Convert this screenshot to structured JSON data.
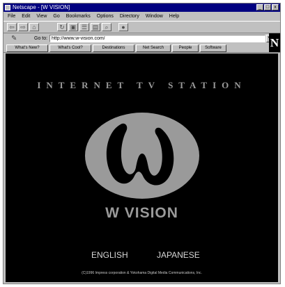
{
  "window": {
    "title": "Netscape - [W VISION]",
    "buttons": [
      "_",
      "□",
      "x"
    ]
  },
  "menu": [
    "File",
    "Edit",
    "View",
    "Go",
    "Bookmarks",
    "Options",
    "Directory",
    "Window",
    "Help"
  ],
  "toolbar": {
    "icons": [
      "back-icon",
      "forward-icon",
      "home-icon",
      "reload-icon",
      "images-icon",
      "open-icon",
      "print-icon",
      "find-icon",
      "stop-icon"
    ]
  },
  "location": {
    "label": "Go to:",
    "url": "http://www.w-vision.com/"
  },
  "directory_buttons": [
    "What's New?",
    "What's Cool?",
    "Destinations",
    "Net Search",
    "People",
    "Software"
  ],
  "branding": {
    "logo_letter": "N"
  },
  "page": {
    "station_title": "INTERNET TV STATION",
    "brand": "W VISION",
    "lang_english": "ENGLISH",
    "lang_japanese": "JAPANESE",
    "copyright": "(C)1996 Impress corporation & Yokohama Digital Media Communications, Inc."
  },
  "colors": {
    "titlebar": "#000080",
    "chrome": "#c0c0c0",
    "page_bg": "#000000",
    "logo_gray": "#9a9a9a"
  }
}
